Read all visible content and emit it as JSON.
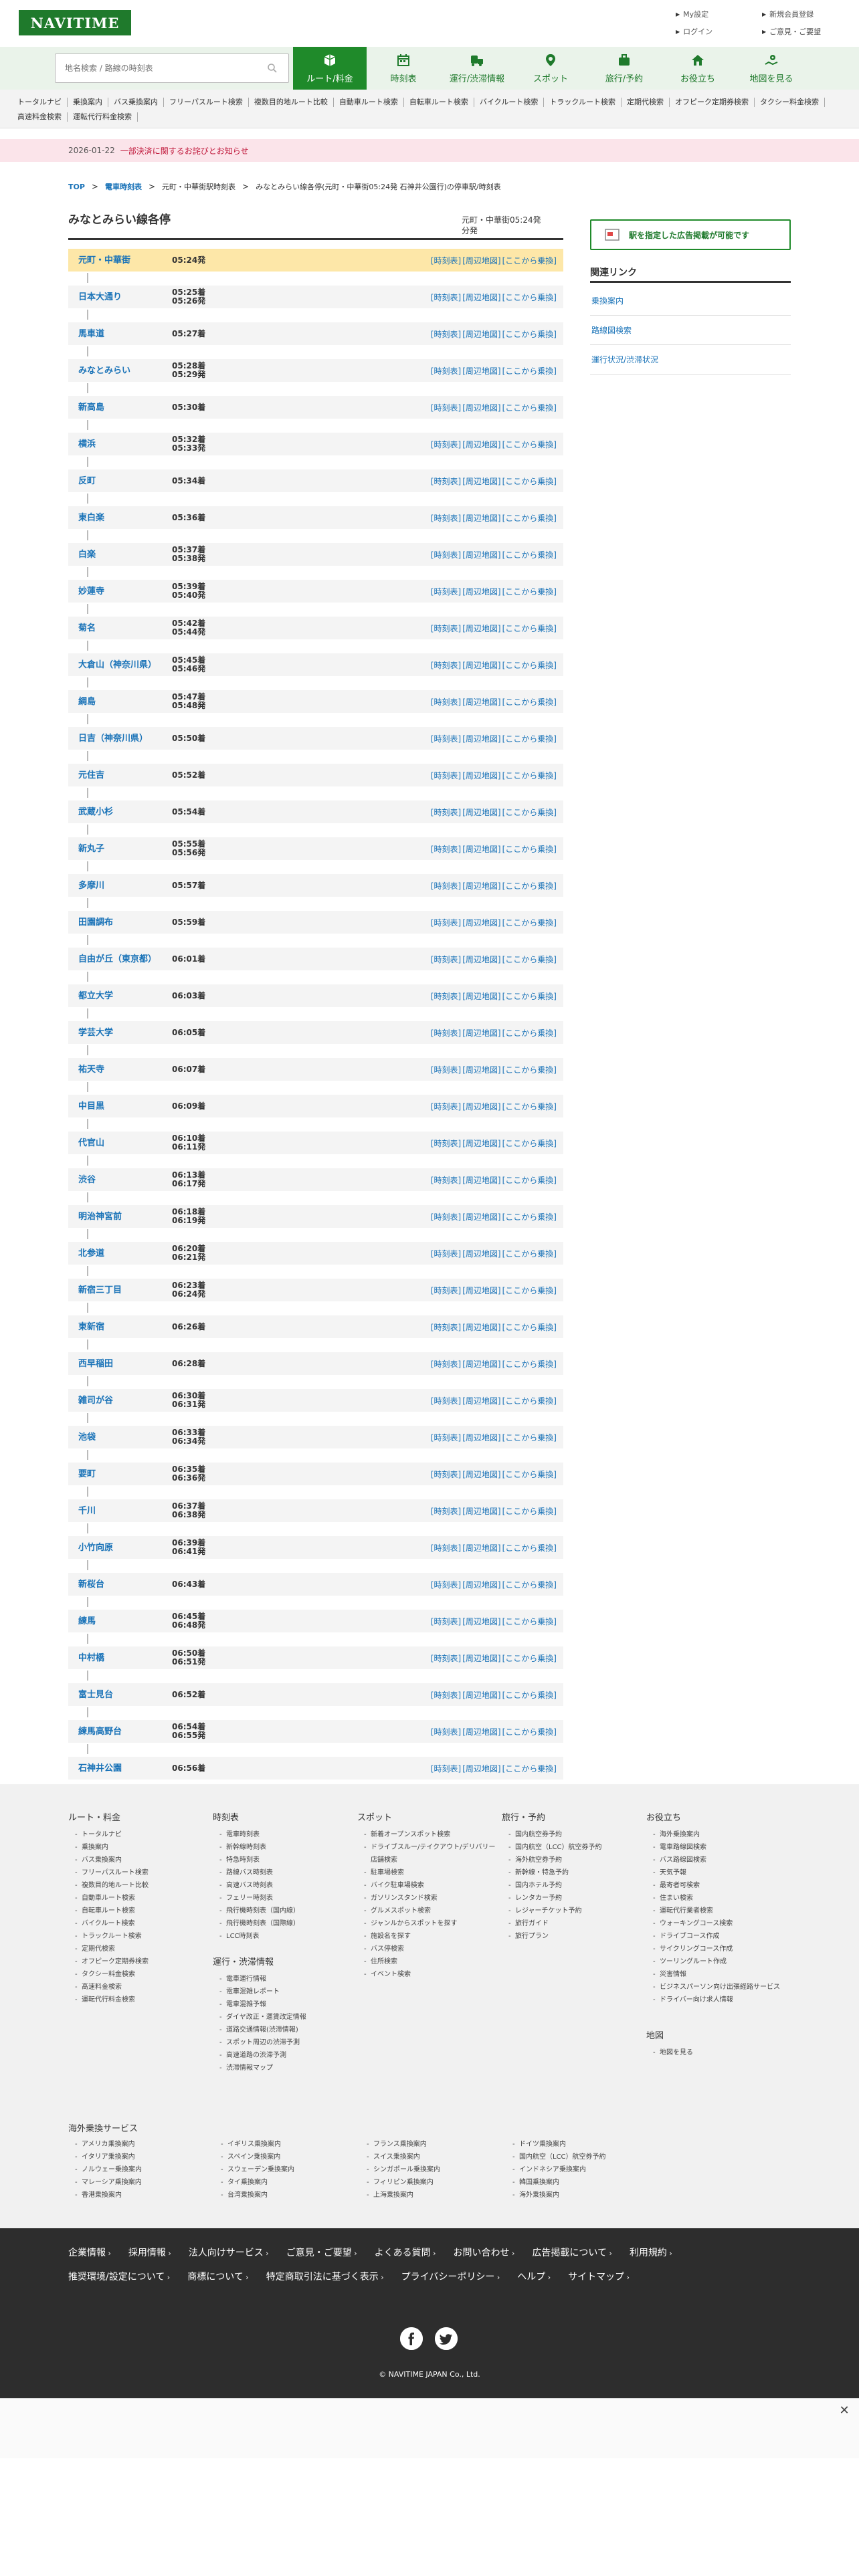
{
  "header": {
    "logo": "NAVITIME",
    "links": [
      "My設定",
      "新規会員登録",
      "ログイン",
      "ご意見・ご要望"
    ]
  },
  "search": {
    "placeholder": "地名検索 / 路線の時刻表"
  },
  "nav": [
    {
      "label": "ルート/料金",
      "icon": "route-icon"
    },
    {
      "label": "時刻表",
      "icon": "calendar-icon"
    },
    {
      "label": "運行/渋滞情報",
      "icon": "traffic-icon"
    },
    {
      "label": "スポット",
      "icon": "pin-icon"
    },
    {
      "label": "旅行/予約",
      "icon": "suitcase-icon"
    },
    {
      "label": "お役立ち",
      "icon": "house-icon"
    },
    {
      "label": "地図を見る",
      "icon": "map-icon"
    }
  ],
  "subnav": [
    "トータルナビ",
    "乗換案内",
    "バス乗換案内",
    "フリーパスルート検索",
    "複数目的地ルート比較",
    "自動車ルート検索",
    "自転車ルート検索",
    "バイクルート検索",
    "トラックルート検索",
    "定期代検索",
    "オフピーク定期券検索",
    "タクシー料金検索",
    "高速料金検索",
    "運転代行料金検索"
  ],
  "notice": {
    "date": "2026-01-22",
    "text": "一部決済に関するお詫びとお知らせ"
  },
  "breadcrumb": [
    "TOP",
    "電車時刻表",
    "元町・中華街駅時刻表",
    "みなとみらい線各停(元町・中華街05:24発 石神井公園行)の停車駅/時刻表"
  ],
  "page": {
    "title": "みなとみらい線各停",
    "route_info": "元町・中華街05:24発",
    "route_info2": "分発"
  },
  "stop_links": {
    "timetable": "[時刻表]",
    "map": "[周辺地図]",
    "ride": "[ここから乗換]"
  },
  "stops": [
    {
      "name": "元町・中華街",
      "t1": "05:24発",
      "t2": ""
    },
    {
      "name": "日本大通り",
      "t1": "05:25着",
      "t2": "05:26発"
    },
    {
      "name": "馬車道",
      "t1": "05:27着",
      "t2": ""
    },
    {
      "name": "みなとみらい",
      "t1": "05:28着",
      "t2": "05:29発"
    },
    {
      "name": "新高島",
      "t1": "05:30着",
      "t2": ""
    },
    {
      "name": "横浜",
      "t1": "05:32着",
      "t2": "05:33発"
    },
    {
      "name": "反町",
      "t1": "05:34着",
      "t2": ""
    },
    {
      "name": "東白楽",
      "t1": "05:36着",
      "t2": ""
    },
    {
      "name": "白楽",
      "t1": "05:37着",
      "t2": "05:38発"
    },
    {
      "name": "妙蓮寺",
      "t1": "05:39着",
      "t2": "05:40発"
    },
    {
      "name": "菊名",
      "t1": "05:42着",
      "t2": "05:44発"
    },
    {
      "name": "大倉山（神奈川県）",
      "t1": "05:45着",
      "t2": "05:46発"
    },
    {
      "name": "綱島",
      "t1": "05:47着",
      "t2": "05:48発"
    },
    {
      "name": "日吉（神奈川県）",
      "t1": "05:50着",
      "t2": ""
    },
    {
      "name": "元住吉",
      "t1": "05:52着",
      "t2": ""
    },
    {
      "name": "武蔵小杉",
      "t1": "05:54着",
      "t2": ""
    },
    {
      "name": "新丸子",
      "t1": "05:55着",
      "t2": "05:56発"
    },
    {
      "name": "多摩川",
      "t1": "05:57着",
      "t2": ""
    },
    {
      "name": "田園調布",
      "t1": "05:59着",
      "t2": ""
    },
    {
      "name": "自由が丘（東京都）",
      "t1": "06:01着",
      "t2": ""
    },
    {
      "name": "都立大学",
      "t1": "06:03着",
      "t2": ""
    },
    {
      "name": "学芸大学",
      "t1": "06:05着",
      "t2": ""
    },
    {
      "name": "祐天寺",
      "t1": "06:07着",
      "t2": ""
    },
    {
      "name": "中目黒",
      "t1": "06:09着",
      "t2": ""
    },
    {
      "name": "代官山",
      "t1": "06:10着",
      "t2": "06:11発"
    },
    {
      "name": "渋谷",
      "t1": "06:13着",
      "t2": "06:17発"
    },
    {
      "name": "明治神宮前",
      "t1": "06:18着",
      "t2": "06:19発"
    },
    {
      "name": "北参道",
      "t1": "06:20着",
      "t2": "06:21発"
    },
    {
      "name": "新宿三丁目",
      "t1": "06:23着",
      "t2": "06:24発"
    },
    {
      "name": "東新宿",
      "t1": "06:26着",
      "t2": ""
    },
    {
      "name": "西早稲田",
      "t1": "06:28着",
      "t2": ""
    },
    {
      "name": "雑司が谷",
      "t1": "06:30着",
      "t2": "06:31発"
    },
    {
      "name": "池袋",
      "t1": "06:33着",
      "t2": "06:34発"
    },
    {
      "name": "要町",
      "t1": "06:35着",
      "t2": "06:36発"
    },
    {
      "name": "千川",
      "t1": "06:37着",
      "t2": "06:38発"
    },
    {
      "name": "小竹向原",
      "t1": "06:39着",
      "t2": "06:41発"
    },
    {
      "name": "新桜台",
      "t1": "06:43着",
      "t2": ""
    },
    {
      "name": "練馬",
      "t1": "06:45着",
      "t2": "06:48発"
    },
    {
      "name": "中村橋",
      "t1": "06:50着",
      "t2": "06:51発"
    },
    {
      "name": "富士見台",
      "t1": "06:52着",
      "t2": ""
    },
    {
      "name": "練馬高野台",
      "t1": "06:54着",
      "t2": "06:55発"
    },
    {
      "name": "石神井公園",
      "t1": "06:56着",
      "t2": ""
    }
  ],
  "sidebar": {
    "ad_button": "駅を指定した広告掲載が可能です",
    "related_title": "関連リンク",
    "related": [
      "乗換案内",
      "路線図検索",
      "運行状況/渋滞状況"
    ]
  },
  "footer": {
    "columns": [
      {
        "head": "ルート・料金",
        "links": [
          "トータルナビ",
          "乗換案内",
          "バス乗換案内",
          "フリーパスルート検索",
          "複数目的地ルート比較",
          "自動車ルート検索",
          "自転車ルート検索",
          "バイクルート検索",
          "トラックルート検索",
          "定期代検索",
          "オフピーク定期券検索",
          "タクシー料金検索",
          "高速料金検索",
          "運転代行料金検索"
        ]
      },
      {
        "head": "時刻表",
        "links": [
          "電車時刻表",
          "新幹線時刻表",
          "特急時刻表",
          "路線バス時刻表",
          "高速バス時刻表",
          "フェリー時刻表",
          "飛行機時刻表（国内線）",
          "飛行機時刻表（国際線）",
          "LCC時刻表"
        ]
      },
      {
        "head": "運行・渋滞情報",
        "links": [
          "電車運行情報",
          "電車混雑レポート",
          "電車混雑予報",
          "ダイヤ改正・運賃改定情報",
          "道路交通情報(渋滞情報)",
          "スポット周辺の渋滞予測",
          "高速道路の渋滞予測",
          "渋滞情報マップ"
        ]
      },
      {
        "head": "スポット",
        "links": [
          "新着オープンスポット検索",
          "ドライブスルー/テイクアウト/デリバリー店舗検索",
          "駐車場検索",
          "バイク駐車場検索",
          "ガソリンスタンド検索",
          "グルメスポット検索",
          "ジャンルからスポットを探す",
          "施設名を探す",
          "バス停検索",
          "住所検索",
          "イベント検索"
        ]
      },
      {
        "head": "旅行・予約",
        "links": [
          "国内航空券予約",
          "国内航空（LCC）航空券予約",
          "海外航空券予約",
          "新幹線・特急予約",
          "国内ホテル予約",
          "レンタカー予約",
          "レジャーチケット予約",
          "旅行ガイド",
          "旅行プラン"
        ]
      },
      {
        "head": "お役立ち",
        "links": [
          "海外乗換案内",
          "電車路線図検索",
          "バス路線図検索",
          "天気予報",
          "最寄者可検索",
          "住まい検索",
          "運転代行業者検索",
          "ウォーキングコース検索",
          "ドライブコース作成",
          "サイクリングコース作成",
          "ツーリングルート作成",
          "災害情報",
          "ビジネスパーソン向け出張経路サービス",
          "ドライバー向け求人情報"
        ]
      },
      {
        "head": "地図",
        "links": [
          "地図を見る"
        ]
      }
    ],
    "overseas_title": "海外乗換サービス",
    "overseas": [
      "アメリカ乗換案内",
      "イギリス乗換案内",
      "フランス乗換案内",
      "ドイツ乗換案内",
      "イタリア乗換案内",
      "スペイン乗換案内",
      "スイス乗換案内",
      "国内航空（LCC）航空券予約",
      "ノルウェー乗換案内",
      "スウェーデン乗換案内",
      "シンガポール乗換案内",
      "インドネシア乗換案内",
      "マレーシア乗換案内",
      "タイ乗換案内",
      "フィリピン乗換案内",
      "韓国乗換案内",
      "香港乗換案内",
      "台湾乗換案内",
      "上海乗換案内",
      "海外乗換案内"
    ],
    "dark_links": [
      "企業情報",
      "採用情報",
      "法人向けサービス",
      "ご意見・ご要望",
      "よくある質問",
      "お問い合わせ",
      "広告掲載について",
      "利用規約",
      "推奨環境/設定について",
      "商標について",
      "特定商取引法に基づく表示",
      "プライバシーポリシー",
      "ヘルプ",
      "サイトマップ"
    ],
    "social": [
      "facebook-icon",
      "twitter-icon"
    ],
    "copyright": "© NAVITIME JAPAN Co., Ltd."
  },
  "colors": {
    "brand": "#1f7a2c",
    "link": "#1a73b8",
    "current_row": "#fde7a8",
    "notice_bg": "#fbe4ea"
  }
}
